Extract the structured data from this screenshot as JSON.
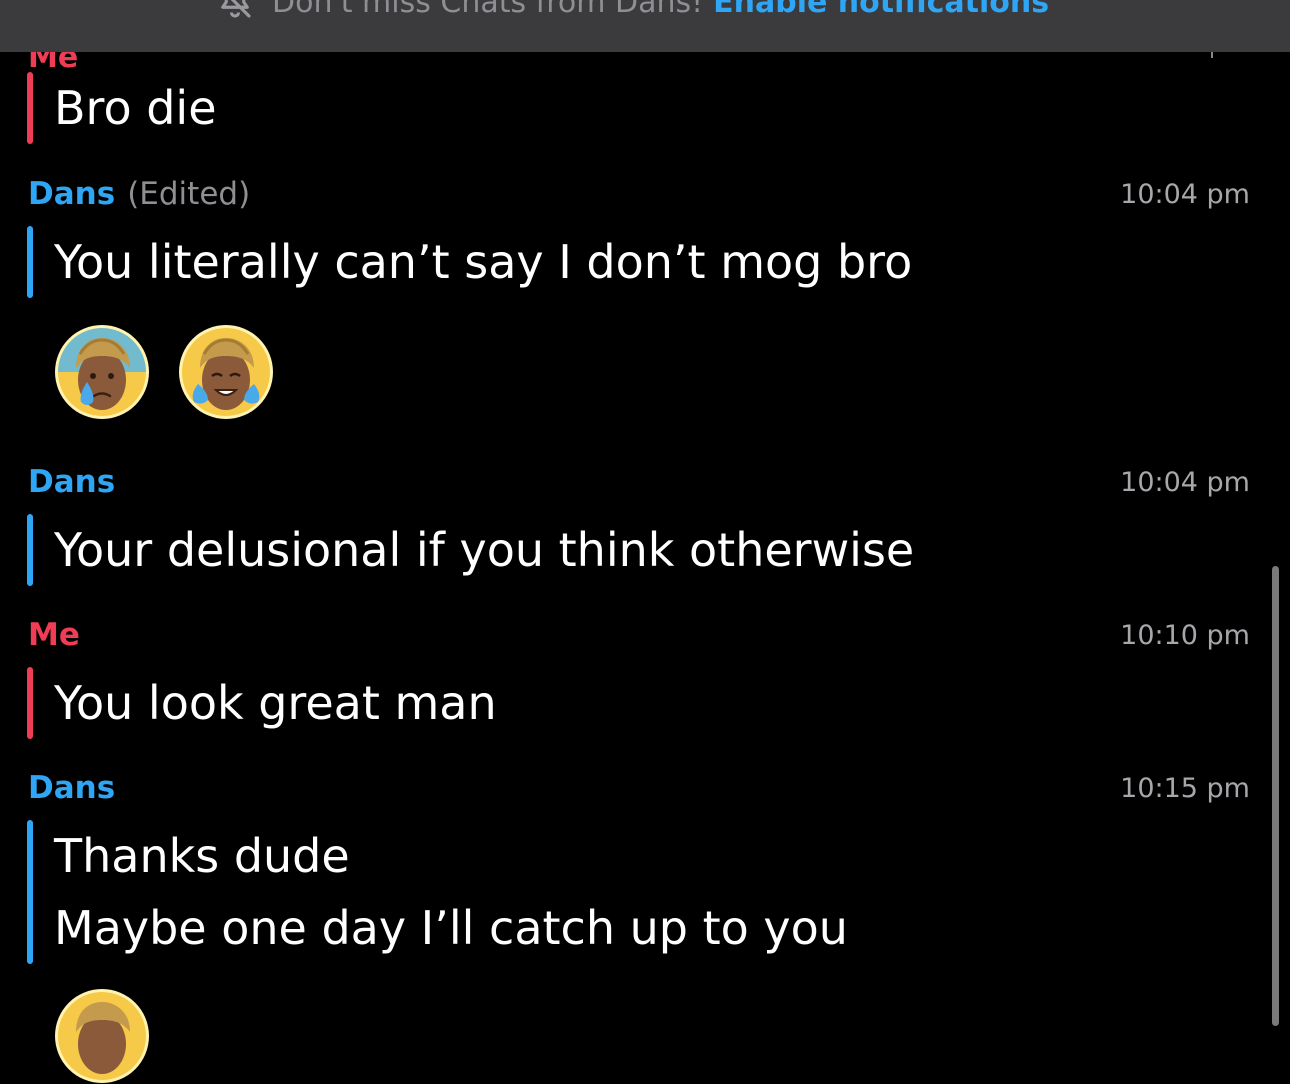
{
  "banner": {
    "text": "Don't miss Chats from Dans!",
    "link": "Enable notifications"
  },
  "previous": {
    "sender": "Me",
    "lines": [
      "Bro die"
    ]
  },
  "messages": [
    {
      "sender": "Dans",
      "edited": "(Edited)",
      "time": "10:04 pm",
      "lines": [
        "You literally can’t say I don’t mog bro"
      ],
      "reactions": [
        "crying-bitmoji-avatar",
        "laughing-crying-bitmoji-avatar"
      ]
    },
    {
      "sender": "Dans",
      "time": "10:04 pm",
      "lines": [
        "Your delusional if you think otherwise"
      ]
    },
    {
      "sender": "Me",
      "time": "10:10 pm",
      "lines": [
        "You look great man"
      ]
    },
    {
      "sender": "Dans",
      "time": "10:15 pm",
      "lines": [
        "Thanks dude",
        "Maybe one day I’ll catch up to you"
      ]
    }
  ],
  "colors": {
    "friend": "#2ea6f5",
    "me": "#ee3d55",
    "background": "#000000",
    "banner": "#3b3b3d"
  }
}
